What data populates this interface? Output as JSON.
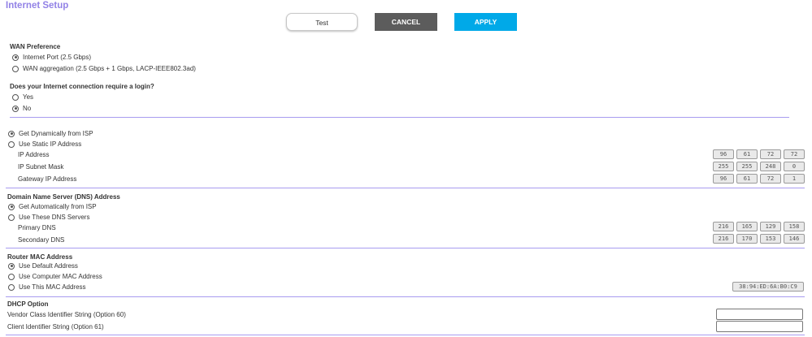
{
  "page": {
    "title": "Internet Setup"
  },
  "buttons": {
    "test": "Test",
    "cancel": "CANCEL",
    "apply": "APPLY"
  },
  "wan": {
    "heading": "WAN Preference",
    "options": [
      "Internet Port (2.5 Gbps)",
      "WAN aggregation (2.5 Gbps + 1 Gbps, LACP-IEEE802.3ad)"
    ],
    "selected": 0
  },
  "login": {
    "question": "Does your Internet connection require a login?",
    "options": [
      "Yes",
      "No"
    ],
    "selected": 1
  },
  "ip": {
    "options": [
      "Get Dynamically from ISP",
      "Use Static IP Address"
    ],
    "selected": 0,
    "ip_address_label": "IP Address",
    "ip_address": [
      "96",
      "61",
      "72",
      "72"
    ],
    "subnet_label": "IP Subnet Mask",
    "subnet": [
      "255",
      "255",
      "248",
      "0"
    ],
    "gateway_label": "Gateway IP Address",
    "gateway": [
      "96",
      "61",
      "72",
      "1"
    ]
  },
  "dns": {
    "heading": "Domain Name Server (DNS) Address",
    "options": [
      "Get Automatically from ISP",
      "Use These DNS Servers"
    ],
    "selected": 0,
    "primary_label": "Primary DNS",
    "primary": [
      "216",
      "165",
      "129",
      "158"
    ],
    "secondary_label": "Secondary DNS",
    "secondary": [
      "216",
      "170",
      "153",
      "146"
    ]
  },
  "mac": {
    "heading": "Router MAC Address",
    "options": [
      "Use Default Address",
      "Use Computer MAC Address",
      "Use This MAC Address"
    ],
    "selected": 0,
    "value": "38:94:ED:6A:B0:C9"
  },
  "dhcp": {
    "heading": "DHCP Option",
    "vendor_label": "Vendor Class Identifier String (Option 60)",
    "vendor_value": "",
    "client_label": "Client Identifier String (Option 61)",
    "client_value": ""
  },
  "colors": {
    "title": "#9282e6",
    "separator": "#a89cf0",
    "cancel_bg": "#5c5c5c",
    "apply_bg": "#00a9e8"
  }
}
